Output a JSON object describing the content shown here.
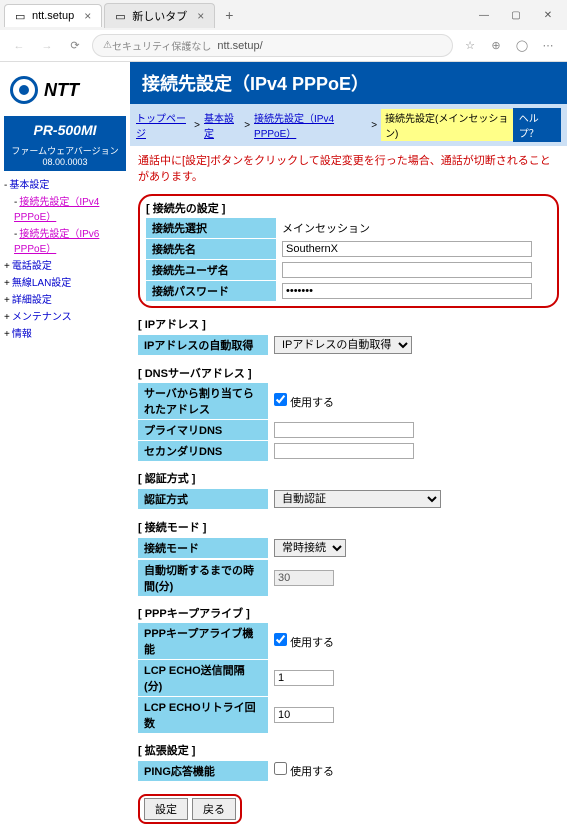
{
  "browser": {
    "tab1": "ntt.setup",
    "tab2": "新しいタブ",
    "security_warn": "セキュリティ保護なし",
    "url": "ntt.setup/"
  },
  "sidebar": {
    "logo_text": "NTT",
    "model": "PR-500MI",
    "fw_label": "ファームウェアバージョン",
    "fw_ver": "08.00.0003",
    "nav": {
      "n0": "基本設定",
      "n1": "接続先設定（IPv4 PPPoE）",
      "n2": "接続先設定（IPv6 PPPoE）",
      "n3": "電話設定",
      "n4": "無線LAN設定",
      "n5": "詳細設定",
      "n6": "メンテナンス",
      "n7": "情報"
    }
  },
  "main": {
    "title": "接続先設定（IPv4 PPPoE）",
    "bc": {
      "b0": "トップページ",
      "b1": "基本設定",
      "b2": "接続先設定（IPv4 PPPoE）",
      "b3": "接続先設定(メインセッション)",
      "help": "ヘルプ？"
    },
    "warning": "通話中に[設定]ボタンをクリックして設定変更を行った場合、通話が切断されることがあります。",
    "conn": {
      "title": "[ 接続先の設定 ]",
      "l_sel": "接続先選択",
      "v_sel": "メインセッション",
      "l_name": "接続先名",
      "v_name": "SouthernX",
      "l_user": "接続先ユーザ名",
      "v_user": "",
      "l_pass": "接続パスワード",
      "v_pass": "•••••••"
    },
    "ip": {
      "title": "[ IPアドレス ]",
      "l_auto": "IPアドレスの自動取得",
      "opt": "IPアドレスの自動取得"
    },
    "dns": {
      "title": "[ DNSサーバアドレス ]",
      "l_auto": "サーバから割り当てられたアドレス",
      "chk": "使用する",
      "l_pri": "プライマリDNS",
      "l_sec": "セカンダリDNS"
    },
    "auth": {
      "title": "[ 認証方式 ]",
      "l_mode": "認証方式",
      "opt": "自動認証"
    },
    "mode": {
      "title": "[ 接続モード ]",
      "l_mode": "接続モード",
      "opt": "常時接続",
      "l_idle": "自動切断するまでの時間(分)",
      "v_idle": "30"
    },
    "keep": {
      "title": "[ PPPキープアライブ ]",
      "l_ka": "PPPキープアライブ機能",
      "chk": "使用する",
      "l_int": "LCP ECHO送信間隔(分)",
      "v_int": "1",
      "l_retry": "LCP ECHOリトライ回数",
      "v_retry": "10"
    },
    "ext": {
      "title": "[ 拡張設定 ]",
      "l_ping": "PING応答機能",
      "chk": "使用する"
    },
    "btn": {
      "set": "設定",
      "back": "戻る"
    }
  }
}
